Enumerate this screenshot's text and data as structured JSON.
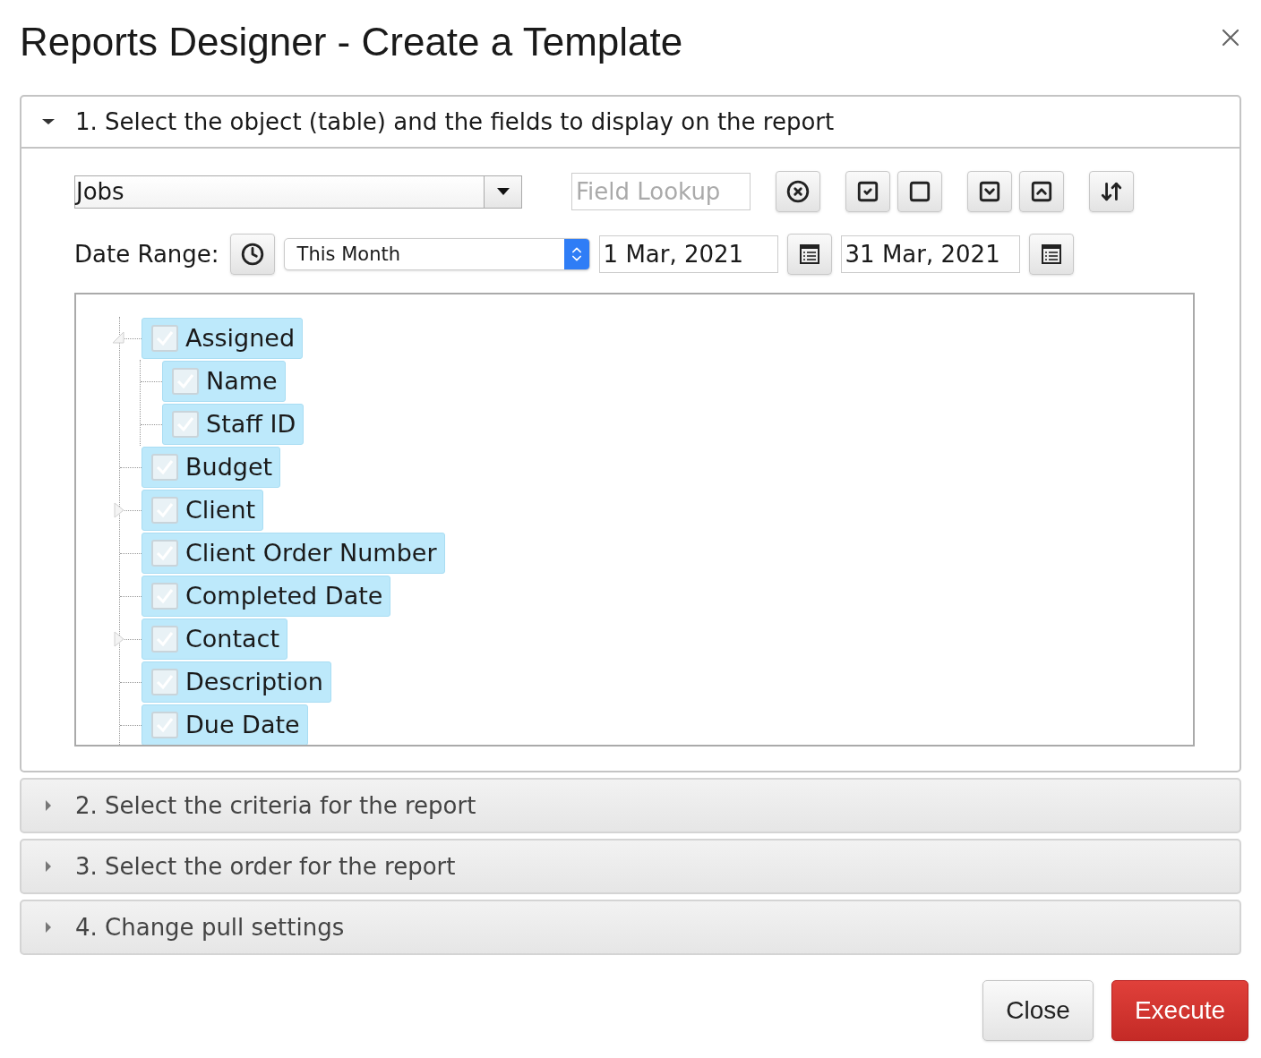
{
  "window": {
    "title": "Reports Designer - Create a Template"
  },
  "sections": [
    {
      "title": "1. Select the object (table) and the fields to display on the report",
      "expanded": true
    },
    {
      "title": "2. Select the criteria for the report",
      "expanded": false
    },
    {
      "title": "3. Select the order for the report",
      "expanded": false
    },
    {
      "title": "4. Change pull settings",
      "expanded": false
    }
  ],
  "object_select": {
    "value": "Jobs"
  },
  "field_lookup": {
    "placeholder": "Field Lookup"
  },
  "date_range": {
    "label": "Date Range:",
    "preset": "This Month",
    "from": "1 Mar, 2021",
    "to": "31 Mar, 2021"
  },
  "fields_tree": [
    {
      "label": "Assigned",
      "checked": true,
      "selected": true,
      "expanded": true,
      "children": [
        {
          "label": "Name",
          "checked": true,
          "selected": true
        },
        {
          "label": "Staff ID",
          "checked": true,
          "selected": true
        }
      ]
    },
    {
      "label": "Budget",
      "checked": true,
      "selected": true
    },
    {
      "label": "Client",
      "checked": true,
      "selected": true,
      "expanded": false
    },
    {
      "label": "Client Order Number",
      "checked": true,
      "selected": true
    },
    {
      "label": "Completed Date",
      "checked": true,
      "selected": true
    },
    {
      "label": "Contact",
      "checked": true,
      "selected": true,
      "expanded": false
    },
    {
      "label": "Description",
      "checked": true,
      "selected": true
    },
    {
      "label": "Due Date",
      "checked": true,
      "selected": true
    }
  ],
  "buttons": [
    {
      "label": "Close",
      "kind": "secondary"
    },
    {
      "label": "Execute",
      "kind": "primary"
    }
  ]
}
